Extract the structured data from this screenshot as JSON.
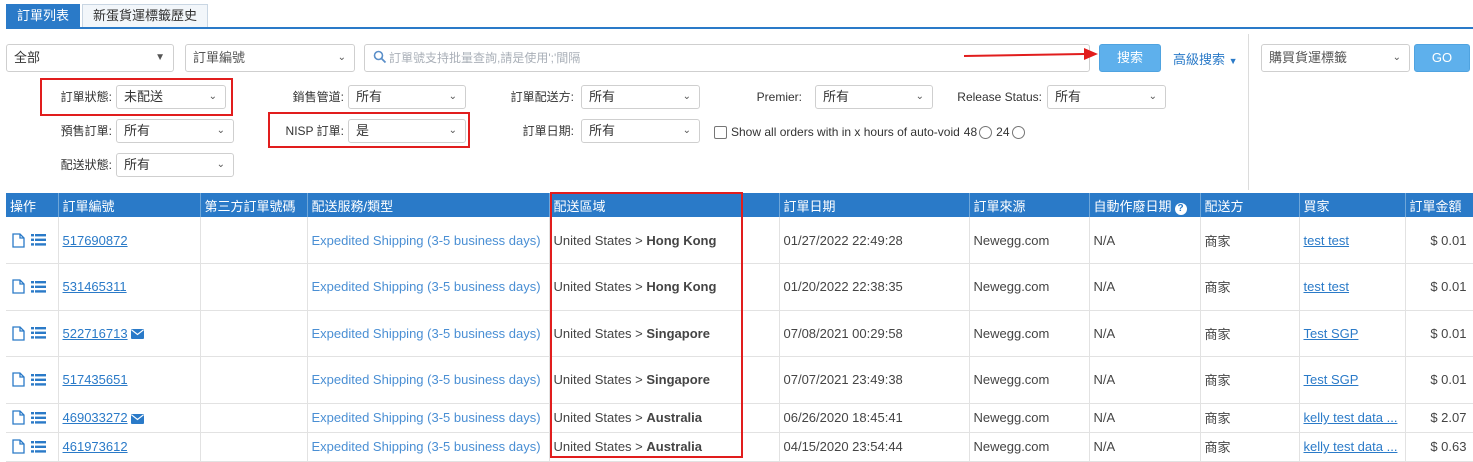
{
  "tabs": [
    {
      "label": "訂單列表",
      "active": true
    },
    {
      "label": "新蛋貨運標籤歷史",
      "active": false
    }
  ],
  "search": {
    "scope_value": "全部",
    "field_value": "訂單編號",
    "placeholder": "訂單號支持批量查詢,請是使用';'間隔",
    "button_label": "搜索",
    "advanced_label": "高級搜索",
    "label_select_value": "購買貨運標籤",
    "go_label": "GO"
  },
  "filters": {
    "order_status": {
      "label": "訂單狀態:",
      "value": "未配送"
    },
    "presale": {
      "label": "預售訂單:",
      "value": "所有"
    },
    "delivery_status": {
      "label": "配送狀態:",
      "value": "所有"
    },
    "sales_channel": {
      "label": "銷售管道:",
      "value": "所有"
    },
    "nisp": {
      "label": "NISP 訂單:",
      "value": "是"
    },
    "fulfillment": {
      "label": "訂單配送方:",
      "value": "所有"
    },
    "order_date": {
      "label": "訂單日期:",
      "value": "所有"
    },
    "premier": {
      "label": "Premier:",
      "value": "所有"
    },
    "release_status": {
      "label": "Release Status:",
      "value": "所有"
    },
    "auto_void_label": "Show all orders with in x hours of auto-void",
    "auto_void_48": "48",
    "auto_void_24": "24"
  },
  "table": {
    "headers": [
      "操作",
      "訂單編號",
      "第三方訂單號碼",
      "配送服務/類型",
      "配送區域",
      "訂單日期",
      "訂單來源",
      "自動作廢日期",
      "配送方",
      "買家",
      "訂單金額"
    ],
    "rows": [
      {
        "order_no": "517690872",
        "mail": false,
        "third_party": "",
        "service": "Expedited Shipping (3-5 business days)",
        "region_prefix": "United States > ",
        "region_dest": "Hong Kong",
        "date": "01/27/2022 22:49:28",
        "source": "Newegg.com",
        "void_date": "N/A",
        "shipper": "商家",
        "buyer": "test test",
        "amount": "$ 0.01"
      },
      {
        "order_no": "531465311",
        "mail": false,
        "third_party": "",
        "service": "Expedited Shipping (3-5 business days)",
        "region_prefix": "United States > ",
        "region_dest": "Hong Kong",
        "date": "01/20/2022 22:38:35",
        "source": "Newegg.com",
        "void_date": "N/A",
        "shipper": "商家",
        "buyer": "test test",
        "amount": "$ 0.01"
      },
      {
        "order_no": "522716713",
        "mail": true,
        "third_party": "",
        "service": "Expedited Shipping (3-5 business days)",
        "region_prefix": "United States > ",
        "region_dest": "Singapore",
        "date": "07/08/2021 00:29:58",
        "source": "Newegg.com",
        "void_date": "N/A",
        "shipper": "商家",
        "buyer": "Test SGP",
        "amount": "$ 0.01"
      },
      {
        "order_no": "517435651",
        "mail": false,
        "third_party": "",
        "service": "Expedited Shipping (3-5 business days)",
        "region_prefix": "United States > ",
        "region_dest": "Singapore",
        "date": "07/07/2021 23:49:38",
        "source": "Newegg.com",
        "void_date": "N/A",
        "shipper": "商家",
        "buyer": "Test SGP",
        "amount": "$ 0.01"
      },
      {
        "order_no": "469033272",
        "mail": true,
        "third_party": "",
        "service": "Expedited Shipping (3-5 business days)",
        "region_prefix": "United States > ",
        "region_dest": "Australia",
        "date": "06/26/2020 18:45:41",
        "source": "Newegg.com",
        "void_date": "N/A",
        "shipper": "商家",
        "buyer": "kelly test data ...",
        "amount": "$ 2.07"
      },
      {
        "order_no": "461973612",
        "mail": false,
        "third_party": "",
        "service": "Expedited Shipping (3-5 business days)",
        "region_prefix": "United States > ",
        "region_dest": "Australia",
        "date": "04/15/2020 23:54:44",
        "source": "Newegg.com",
        "void_date": "N/A",
        "shipper": "商家",
        "buyer": "kelly test data ...",
        "amount": "$ 0.63"
      }
    ]
  },
  "colors": {
    "primary": "#2a7ac8",
    "button": "#5eb0ec",
    "highlight": "#e11d1d"
  }
}
